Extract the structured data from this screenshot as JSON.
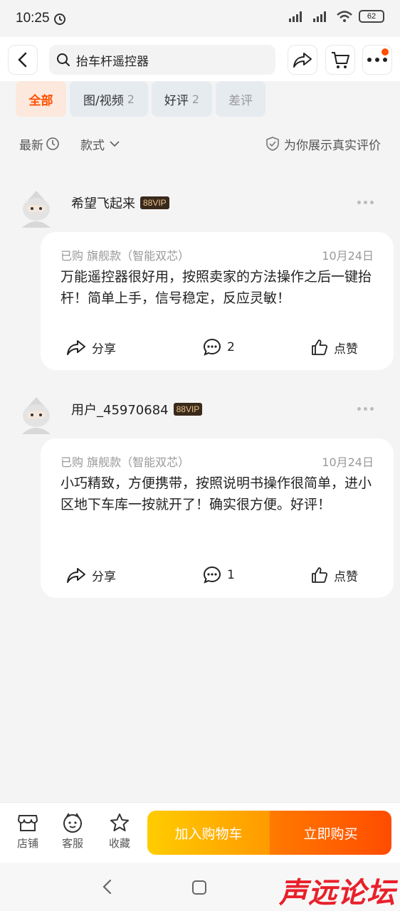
{
  "status_bar": {
    "time": "10:25",
    "battery": "62"
  },
  "search": {
    "query": "抬车杆遥控器"
  },
  "tabs": [
    {
      "label": "全部",
      "count": ""
    },
    {
      "label": "图/视频",
      "count": "2"
    },
    {
      "label": "好评",
      "count": "2"
    },
    {
      "label": "差评",
      "count": ""
    }
  ],
  "sort": {
    "latest": "最新",
    "style": "款式",
    "genuine": "为你展示真实评价"
  },
  "reviews": [
    {
      "user": "希望飞起来",
      "vip": "88VIP",
      "meta": "已购 旗舰款（智能双芯）",
      "date": "10月24日",
      "text": "万能遥控器很好用，按照卖家的方法操作之后一键抬杆！简单上手，信号稳定，反应灵敏！",
      "share_label": "分享",
      "comment_count": "2",
      "like_label": "点赞"
    },
    {
      "user": "用户_45970684",
      "vip": "88VIP",
      "meta": "已购 旗舰款（智能双芯）",
      "date": "10月24日",
      "text": "小巧精致，方便携带，按照说明书操作很简单，进小区地下车库一按就开了！确实很方便。好评！",
      "share_label": "分享",
      "comment_count": "1",
      "like_label": "点赞"
    }
  ],
  "bottom_bar": {
    "store": "店铺",
    "service": "客服",
    "favorite": "收藏",
    "add_cart": "加入购物车",
    "buy_now": "立即购买"
  },
  "watermark": "声远论坛",
  "colors": {
    "accent": "#ff5000",
    "cart_button": "#ffb400",
    "buy_button": "#ff5a00"
  }
}
